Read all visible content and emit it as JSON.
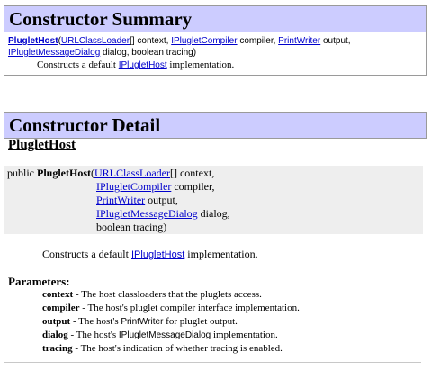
{
  "summary": {
    "title": "Constructor Summary",
    "ctor_name": "PlugletHost",
    "p1_type": "URLClassLoader",
    "p1_rest": "[] context, ",
    "p2_type": "IPlugletCompiler",
    "p2_rest": " compiler, ",
    "p3_type": "PrintWriter",
    "p3_rest": " output,",
    "p4_type": "IPlugletMessageDialog",
    "p4_rest": " dialog, boolean tracing)",
    "desc_prefix": "Constructs a default ",
    "desc_link": "IPlugletHost",
    "desc_suffix": " implementation."
  },
  "detail": {
    "title": "Constructor Detail",
    "heading": "PlugletHost",
    "sig": {
      "modifier": "public ",
      "name": "PlugletHost",
      "open": "(",
      "p1_type": "URLClassLoader",
      "p1_rest": "[] context,",
      "p2_type": "IPlugletCompiler",
      "p2_rest": " compiler,",
      "p3_type": "PrintWriter",
      "p3_rest": " output,",
      "p4_type": "IPlugletMessageDialog",
      "p4_rest": " dialog,",
      "p5": "boolean tracing)"
    },
    "desc_prefix": "Constructs a default ",
    "desc_link": "IPlugletHost",
    "desc_suffix": " implementation.",
    "params_heading": "Parameters:",
    "params": [
      {
        "name": "context",
        "pre": " - The host classloaders that the pluglets access.",
        "code": "",
        "post": ""
      },
      {
        "name": "compiler",
        "pre": " - The host's pluglet compiler interface implementation.",
        "code": "",
        "post": ""
      },
      {
        "name": "output",
        "pre": " - The host's ",
        "code": "PrintWriter",
        "post": " for pluglet output."
      },
      {
        "name": "dialog",
        "pre": " - The host's ",
        "code": "IPlugletMessageDialog",
        "post": " implementation."
      },
      {
        "name": "tracing",
        "pre": " - The host's indication of whether tracing is enabled.",
        "code": "",
        "post": ""
      }
    ]
  }
}
